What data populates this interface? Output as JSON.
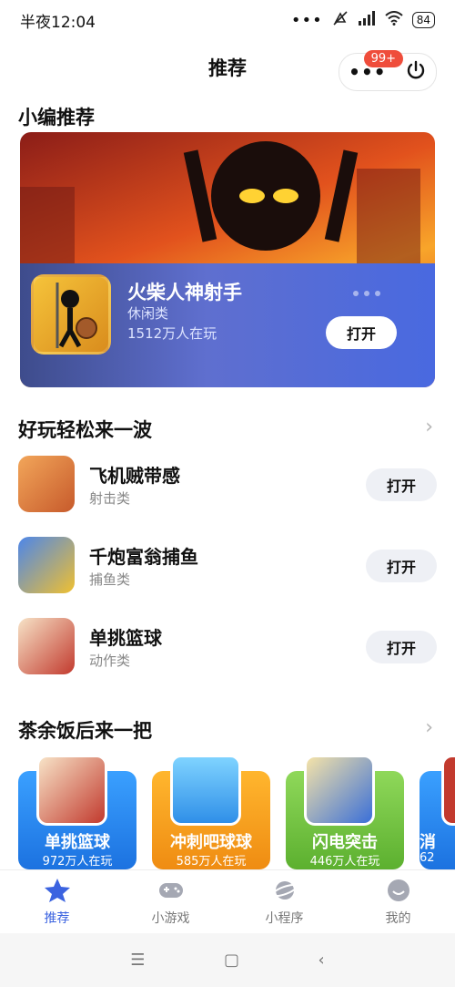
{
  "status": {
    "time": "半夜12:04",
    "battery": "84"
  },
  "header": {
    "title": "推荐",
    "badge": "99+",
    "more": "•••"
  },
  "featured": {
    "section_title": "小编推荐",
    "game": {
      "name": "火柴人神射手",
      "category": "休闲类",
      "players": "1512万人在玩",
      "button": "打开"
    }
  },
  "easy": {
    "section_title": "好玩轻松来一波",
    "items": [
      {
        "name": "飞机贼带感",
        "category": "射击类",
        "button": "打开",
        "color": "#e9874a"
      },
      {
        "name": "千炮富翁捕鱼",
        "category": "捕鱼类",
        "button": "打开",
        "color": "#3e6fd6"
      },
      {
        "name": "单挑篮球",
        "category": "动作类",
        "button": "打开",
        "color": "#f3d9b8"
      }
    ]
  },
  "after_meal": {
    "section_title": "茶余饭后来一把",
    "cards": [
      {
        "name": "单挑篮球",
        "players": "972万人在玩",
        "color": "#2e8ff0"
      },
      {
        "name": "冲刺吧球球",
        "players": "585万人在玩",
        "color": "#f0a21e"
      },
      {
        "name": "闪电突击",
        "players": "446万人在玩",
        "color": "#7bc94a"
      },
      {
        "name": "消",
        "players": "62",
        "color": "#2e8ff0"
      }
    ]
  },
  "tabs": [
    {
      "label": "推荐",
      "active": true
    },
    {
      "label": "小游戏",
      "active": false
    },
    {
      "label": "小程序",
      "active": false
    },
    {
      "label": "我的",
      "active": false
    }
  ]
}
